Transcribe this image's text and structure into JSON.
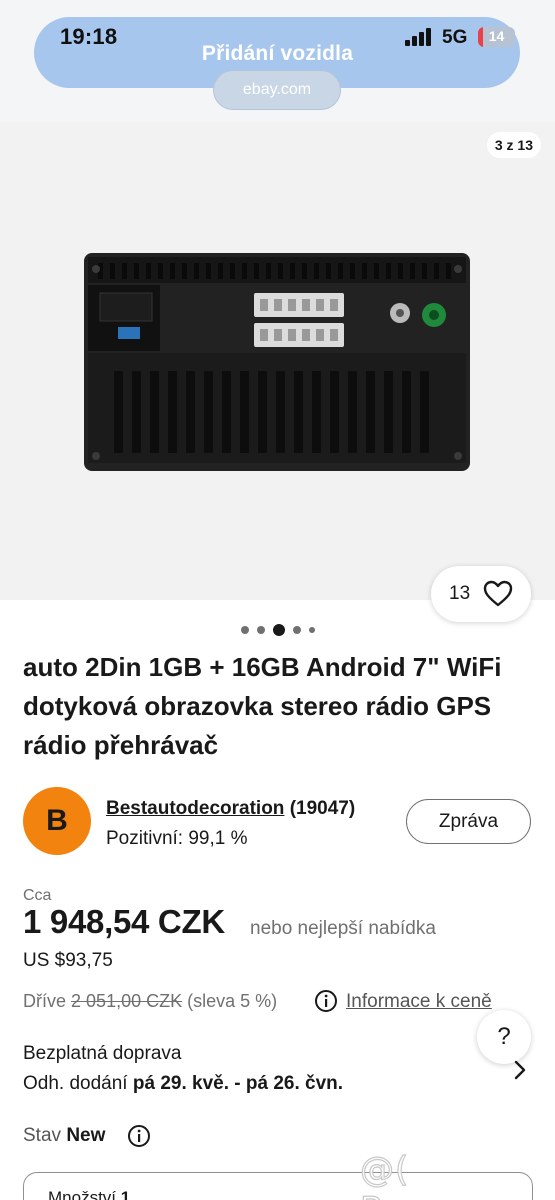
{
  "status_bar": {
    "time": "19:18",
    "network": "5G",
    "battery": "14",
    "battery_level": 0.14
  },
  "browser": {
    "page_title": "Přidání vozidla",
    "domain": "ebay.com"
  },
  "gallery": {
    "counter": "3 z 13",
    "watch_count": "13",
    "dots_total": 5,
    "active_dot": 2
  },
  "listing": {
    "title": "auto 2Din 1GB + 16GB Android 7\" WiFi dotyková obrazovka stereo rádio GPS rádio přehrávač",
    "seller": {
      "avatar_letter": "B",
      "name": "Bestautodecoration",
      "feedback_count": "(19047)",
      "rating": "Pozitivní: 99,1 %",
      "message_button": "Zpráva"
    },
    "price": {
      "approx_label": "Cca",
      "amount": "1 948,54 CZK",
      "best_offer": "nebo nejlepší nabídka",
      "usd": "US $93,75",
      "was_label": "Dříve",
      "was_amount": "2 051,00 CZK",
      "discount": "(sleva 5 %)",
      "info_link": "Informace k ceně"
    },
    "shipping": {
      "free": "Bezplatná doprava",
      "delivery_label": "Odh. dodání",
      "delivery_dates": "pá 29. kvě. - pá 26. čvn."
    },
    "condition": {
      "label": "Stav",
      "value": "New"
    },
    "quantity": {
      "label": "Množství",
      "value": "1"
    }
  },
  "help_button": "?",
  "watermark": "@( Bazos.cz",
  "colors": {
    "url_pill": "#a7c6ee",
    "avatar": "#f2830f",
    "battery_fill": "#e8414c"
  }
}
